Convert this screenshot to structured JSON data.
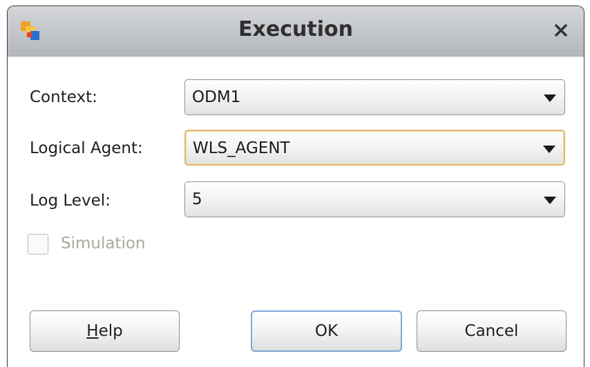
{
  "window": {
    "title": "Execution",
    "app_icon": "odi-app-icon",
    "close_icon": "close-icon"
  },
  "fields": {
    "context": {
      "label": "Context:",
      "value": "ODM1"
    },
    "logical_agent": {
      "label": "Logical Agent:",
      "value": "WLS_AGENT"
    },
    "log_level": {
      "label": "Log Level:",
      "value": "5"
    }
  },
  "simulation": {
    "label": "Simulation",
    "checked": false,
    "enabled": false
  },
  "buttons": {
    "help_mnemonic": "H",
    "help_rest": "elp",
    "ok": "OK",
    "cancel": "Cancel"
  },
  "colors": {
    "focus_border": "#e2b872",
    "default_button_border": "#7ea6d6",
    "disabled_text": "#a9aaa1"
  }
}
